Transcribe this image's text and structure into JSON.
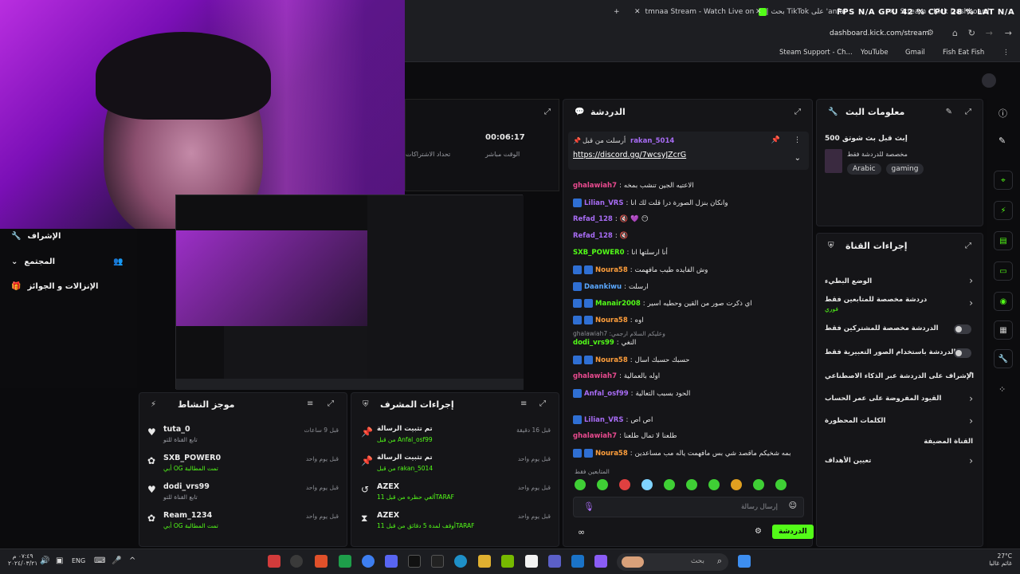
{
  "browser": {
    "tabs": [
      {
        "label": "tmnaa Stream - Watch Live on"
      },
      {
        "label": "| بحث TikTok على 'anfal'"
      },
      {
        "label": "Stream - Kick Dashboard"
      }
    ],
    "url": "dashboard.kick.com/stream",
    "bookmarks": [
      "Steam Support - Ch...",
      "YouTube",
      "Gmail",
      "Fish Eat Fish"
    ],
    "hud": "FPS N/A   GPU 42 %   CPU 28 %   LAT N/A"
  },
  "stats": {
    "time": "00:06:17",
    "time_label": "الوقت مباشر",
    "subs_label": "تحداد الاشتراكات"
  },
  "side_menu": [
    {
      "label": "الإشراف"
    },
    {
      "label": "المجتمع"
    },
    {
      "label": "الإنزالات و الجوائز"
    }
  ],
  "chat": {
    "title": "الدردشة",
    "pinned": {
      "prefix": "أرسلت من قبل",
      "user": "rakan_5014",
      "link": "https://discord.gg/7wcsyJZcrG"
    },
    "messages": [
      {
        "user": "ghalawiah7",
        "color": "#e94a8f",
        "text": "الاعتيه الجين تنشب بمخه"
      },
      {
        "user": "Lilian_VRS",
        "color": "#a86cf5",
        "text": "وانكان بنزل الصورة درا قلت لك انا"
      },
      {
        "user": "Refad_128",
        "color": "#a86cf5",
        "text": ""
      },
      {
        "user": "Refad_128",
        "color": "#a86cf5",
        "text": ""
      },
      {
        "user": "SXB_POWER0",
        "color": "#53fc18",
        "text": "أنا ارسلتها انا"
      },
      {
        "user": "Noura58",
        "color": "#ff9e3b",
        "text": "وش الفايده طيب مافهمت"
      },
      {
        "user": "Daankiwu",
        "color": "#5aa8ff",
        "text": "ارسلت"
      },
      {
        "user": "Manair2008",
        "color": "#53fc18",
        "text": "اي ذكرت صور من القين وحطيه اسير"
      },
      {
        "user": "Noura58",
        "color": "#ff9e3b",
        "text": "اوه"
      },
      {
        "user": "dodi_vrs99",
        "color": "#53fc18",
        "text": "النغي"
      },
      {
        "user": "Noura58",
        "color": "#ff9e3b",
        "text": "حسبك حسبك اسال"
      },
      {
        "user": "ghalawiah7",
        "color": "#e94a8f",
        "text": "اوله بالعمالية"
      },
      {
        "user": "Anfal_osf99",
        "color": "#a86cf5",
        "text": "الحود بسبب التعالية"
      },
      {
        "user": "Lilian_VRS",
        "color": "#a86cf5",
        "text": "اص اص"
      },
      {
        "user": "ghalawiah7",
        "color": "#e94a8f",
        "text": "طلعنا لا تمال طلعنا"
      },
      {
        "user": "Noura58",
        "color": "#ff9e3b",
        "text": "بمه شخيكم ماقصد شي بس مافهمت ياله مب مساعدين"
      }
    ],
    "reply_context": "ghalawiah7 :وعليكم السلام ارجمي",
    "followers_only": "المتابعين فقط",
    "input_placeholder": "إرسال رسالة",
    "send_label": "الدردشة"
  },
  "stream_info": {
    "title": "معلومات البث",
    "stream_title": "إبث قبل بث شوتق 500",
    "subtitle": "مخصصة للدردشة فقط",
    "tags": [
      "Arabic",
      "gaming"
    ]
  },
  "channel_actions": {
    "title": "إجراءات القناة",
    "items": [
      {
        "label": "الوضع البطيء",
        "type": "chevron"
      },
      {
        "label": "دردشة مخصصة للمتابعين فقط",
        "sub": "فوري",
        "type": "chevron"
      },
      {
        "label": "الدردشة مخصصة للمشتركين فقط",
        "type": "toggle"
      },
      {
        "label": "الدردشة باستخدام الصور التعبيرية فقط",
        "type": "toggle"
      },
      {
        "label": "الإشراف على الدردشة عبر الذكاء الاصطناعي",
        "type": "link"
      },
      {
        "label": "القيود المفروضة على عمر الحساب",
        "type": "chevron"
      },
      {
        "label": "الكلمات المحظورة",
        "type": "chevron"
      },
      {
        "label": "القناة المضيفة",
        "type": "none"
      },
      {
        "label": "تعيين الأهداف",
        "type": "chevron"
      }
    ]
  },
  "activity": {
    "title": "موجز النشاط",
    "items": [
      {
        "name": "tuta_0",
        "sub": "تابع القناة للتو",
        "time": "قبل 9 ساعات",
        "icon": "heart"
      },
      {
        "name": "SXB_POWER0",
        "sub": "أبي OG تمت المطالبة",
        "time": "قبل يوم واحد",
        "icon": "gift"
      },
      {
        "name": "dodi_vrs99",
        "sub": "تابع القناة للتو",
        "time": "قبل يوم واحد",
        "icon": "heart"
      },
      {
        "name": "Ream_1234",
        "sub": "أبي OG تمت المطالبة",
        "time": "قبل يوم واحد",
        "icon": "gift"
      }
    ]
  },
  "mod_actions": {
    "title": "إجراءات المشرف",
    "items": [
      {
        "name": "تم تثبيت الرسالة",
        "sub": "من قبل Anfal_osf99",
        "time": "قبل 16 دقيقة",
        "icon": "pin"
      },
      {
        "name": "تم تثبيت الرسالة",
        "sub": "من قبل rakan_5014",
        "time": "قبل يوم واحد",
        "icon": "pin"
      },
      {
        "name": "AZEX",
        "sub": "ألغي حظره من قبل 11TARAF",
        "time": "قبل يوم واحد",
        "icon": "undo"
      },
      {
        "name": "AZEX",
        "sub": "أوقف لمدة 5 دقائق من قبل 11TARAF",
        "time": "قبل يوم واحد",
        "icon": "timer"
      }
    ]
  },
  "taskbar": {
    "search_placeholder": "بحث",
    "lang": "ENG",
    "time": "٠٧:٤٩ م",
    "date": "٢٠٢٤/٠٣/٢١",
    "weather_temp": "27°C",
    "weather_desc": "غائم غالبا",
    "colors": {
      "accent": "#53fc18"
    }
  }
}
